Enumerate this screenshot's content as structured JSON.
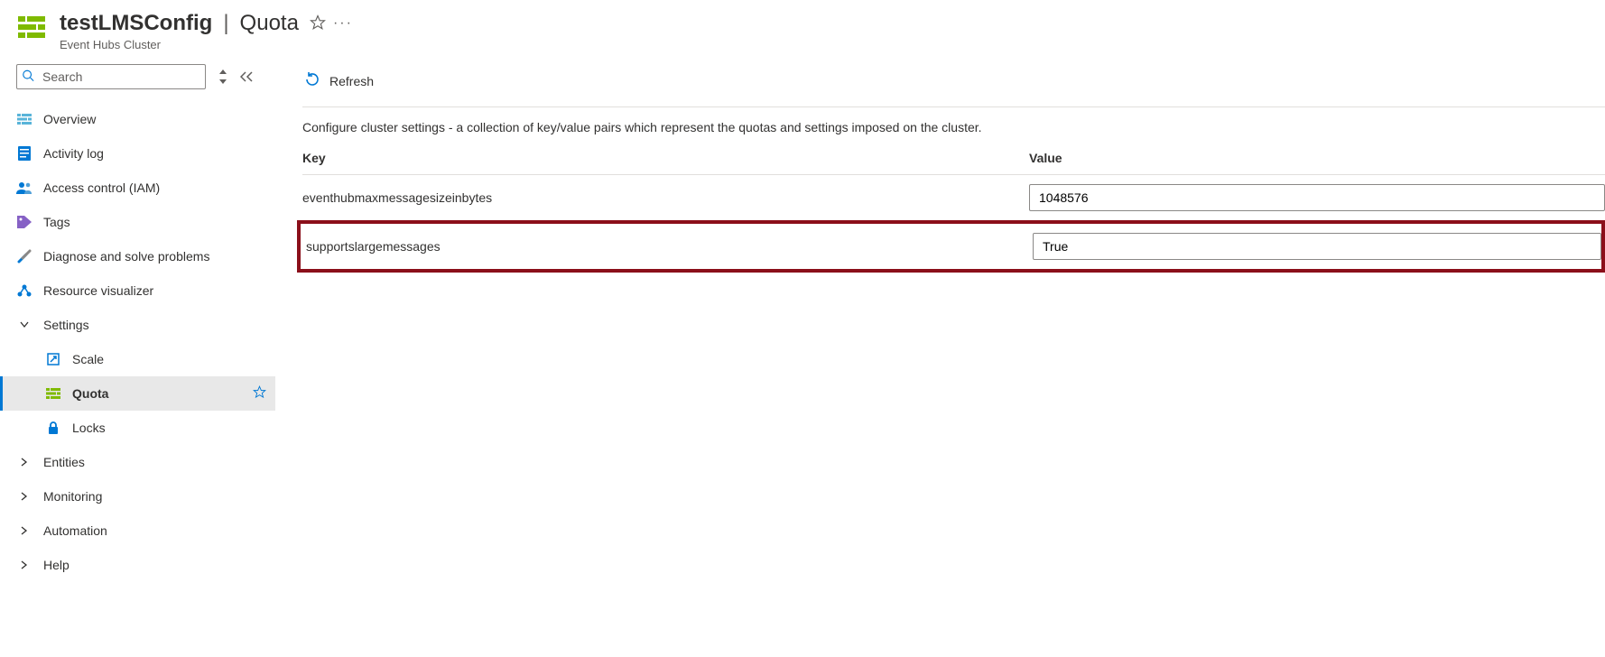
{
  "header": {
    "resource_name": "testLMSConfig",
    "section": "Quota",
    "subtitle": "Event Hubs Cluster"
  },
  "sidebar": {
    "search_placeholder": "Search",
    "items": {
      "overview": "Overview",
      "activity_log": "Activity log",
      "access_control": "Access control (IAM)",
      "tags": "Tags",
      "diagnose": "Diagnose and solve problems",
      "resource_visualizer": "Resource visualizer"
    },
    "groups": {
      "settings": {
        "label": "Settings",
        "children": {
          "scale": "Scale",
          "quota": "Quota",
          "locks": "Locks"
        }
      },
      "entities": "Entities",
      "monitoring": "Monitoring",
      "automation": "Automation",
      "help": "Help"
    }
  },
  "main": {
    "refresh_label": "Refresh",
    "description": "Configure cluster settings - a collection of key/value pairs which represent the quotas and settings imposed on the cluster.",
    "columns": {
      "key": "Key",
      "value": "Value"
    },
    "rows": [
      {
        "key": "eventhubmaxmessagesizeinbytes",
        "value": "1048576",
        "highlight": false
      },
      {
        "key": "supportslargemessages",
        "value": "True",
        "highlight": true
      }
    ]
  }
}
